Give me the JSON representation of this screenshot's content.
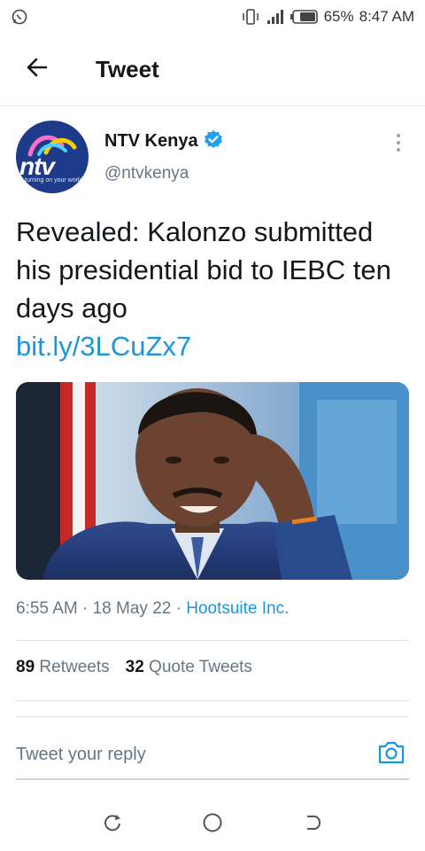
{
  "status_bar": {
    "battery": "65%",
    "time": "8:47 AM",
    "icons": [
      "whatsapp-icon",
      "vibrate-icon",
      "signal-icon",
      "battery-icon"
    ]
  },
  "app_bar": {
    "title": "Tweet",
    "back_icon": "arrow-left-icon"
  },
  "tweet": {
    "author": {
      "name": "NTV Kenya",
      "handle": "@ntvkenya",
      "verified": true,
      "avatar_text": "ntv",
      "avatar_tagline": "turning on your world"
    },
    "text": "Revealed: Kalonzo submitted his presidential bid to IEBC ten days ago",
    "link": "bit.ly/3LCuZx7",
    "time": "6:55 AM",
    "separator": " · ",
    "date": "18 May 22",
    "source": "Hootsuite Inc.",
    "stats": {
      "retweets_count": "89",
      "retweets_label": "Retweets",
      "quotes_count": "32",
      "quotes_label": "Quote Tweets"
    }
  },
  "reply": {
    "placeholder": "Tweet your reply"
  },
  "colors": {
    "accent": "#1b95e0",
    "verified": "#1da1f2",
    "text_primary": "#14171a",
    "text_secondary": "#657786"
  }
}
